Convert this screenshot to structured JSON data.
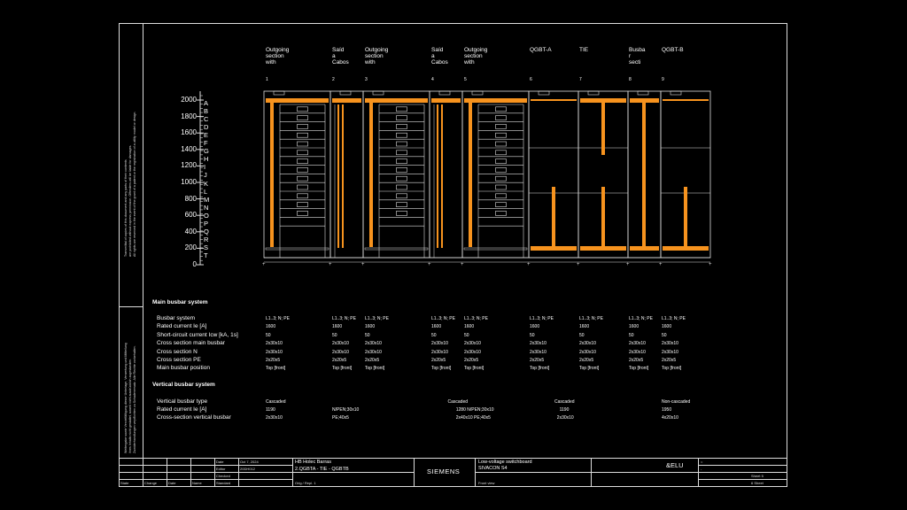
{
  "side_notes": {
    "top": [
      "Transmittal of copies of this document and any parts of their contents",
      "are prohibited without express permission. Offenders will be liable for damages.",
      "All rights are reserved in the event of the grant of a patent or the registration of a utility model or design."
    ],
    "bottom": [
      "Weitergabe sowie Vervielfältigung dieser Unterlage, Verwertung und Mitteilung",
      "ihres Inhalts nicht gestattet, soweit nicht ausdrücklich zugestanden.",
      "Zuwiderhandlungen verpflichten zu Schadenersatz. Alle Rechte vorbehalten."
    ]
  },
  "columns": [
    {
      "head": [
        "Outgoing",
        "section",
        "with"
      ],
      "num": "1"
    },
    {
      "head": [
        "Saíd",
        "a",
        "Cabos"
      ],
      "num": "2"
    },
    {
      "head": [
        "Outgoing",
        "section",
        "with"
      ],
      "num": "3"
    },
    {
      "head": [
        "Saíd",
        "a",
        "Cabos"
      ],
      "num": "4"
    },
    {
      "head": [
        "Outgoing",
        "section",
        "with"
      ],
      "num": "5"
    },
    {
      "head": [
        "QGBT-A"
      ],
      "num": "6"
    },
    {
      "head": [
        "TIE"
      ],
      "num": "7"
    },
    {
      "head": [
        "Busba",
        "r",
        "secti"
      ],
      "num": "8"
    },
    {
      "head": [
        "QGBT-B"
      ],
      "num": "9"
    }
  ],
  "y_axis": {
    "ticks": [
      "2000",
      "1800",
      "1600",
      "1400",
      "1200",
      "1000",
      "800",
      "600",
      "400",
      "200",
      "0"
    ],
    "letters": [
      "A",
      "B",
      "C",
      "D",
      "E",
      "F",
      "G",
      "H",
      "I",
      "J",
      "K",
      "L",
      "M",
      "N",
      "O",
      "P",
      "Q",
      "R",
      "S",
      "T"
    ]
  },
  "main_busbar": {
    "title": "Main busbar system",
    "rows": [
      {
        "label": "Busbar system",
        "values": [
          "L1..3; N; PE",
          "L1..3; N; PE",
          "L1..3; N; PE",
          "L1..3; N; PE",
          "L1..3; N; PE",
          "L1..3; N; PE",
          "L1..3; N; PE",
          "L1..3; N; PE",
          "L1..3; N; PE"
        ]
      },
      {
        "label": "Rated current Ie [A]",
        "values": [
          "1600",
          "1600",
          "1600",
          "1600",
          "1600",
          "1600",
          "1600",
          "1600",
          "1600"
        ]
      },
      {
        "label": "Short-circuit current Icw [kA, 1s]",
        "values": [
          "50",
          "50",
          "50",
          "50",
          "50",
          "50",
          "50",
          "50",
          "50"
        ]
      },
      {
        "label": "Cross section main busbar",
        "values": [
          "2x30x10",
          "2x30x10",
          "2x30x10",
          "2x30x10",
          "2x30x10",
          "2x30x10",
          "2x30x10",
          "2x30x10",
          "2x30x10"
        ]
      },
      {
        "label": "Cross section N",
        "values": [
          "2x30x10",
          "2x30x10",
          "2x30x10",
          "2x30x10",
          "2x30x10",
          "2x30x10",
          "2x30x10",
          "2x30x10",
          "2x30x10"
        ]
      },
      {
        "label": "Cross section PE",
        "values": [
          "2x20x5",
          "2x20x5",
          "2x20x5",
          "2x20x5",
          "2x20x5",
          "2x20x5",
          "2x20x5",
          "2x20x5",
          "2x20x5"
        ]
      },
      {
        "label": "Main busbar position",
        "values": [
          "Top [front]",
          "Top [front]",
          "Top [front]",
          "Top [front]",
          "Top [front]",
          "Top [front]",
          "Top [front]",
          "Top [front]",
          "Top [front]"
        ]
      }
    ]
  },
  "vertical_busbar": {
    "title": "Vertical busbar system",
    "rows": [
      {
        "label": "Vertical busbar type",
        "cells": [
          {
            "c": 0,
            "t": "Cascaded"
          },
          {
            "c": 3.5,
            "t": "Cascaded"
          },
          {
            "c": 5.5,
            "t": "Cascaded"
          },
          {
            "c": 8,
            "t": "Non-cascaded"
          }
        ]
      },
      {
        "label": "Rated current Ie [A]",
        "cells": [
          {
            "c": 0,
            "t": "1190"
          },
          {
            "c": 1,
            "t": "N/PEN;30x10"
          },
          {
            "c": 3.75,
            "t": "1280 N/PEN;30x10"
          },
          {
            "c": 5.6,
            "t": "1190"
          },
          {
            "c": 8,
            "t": "1950"
          }
        ]
      },
      {
        "label": "Cross-section vertical busbar",
        "cells": [
          {
            "c": 0,
            "t": "2x30x10"
          },
          {
            "c": 1,
            "t": "PE;40x5"
          },
          {
            "c": 3.75,
            "t": "2x40x10 PE;40x5"
          },
          {
            "c": 5.55,
            "t": "2x30x10"
          },
          {
            "c": 8,
            "t": "4x20x10"
          }
        ]
      }
    ]
  },
  "title_block": {
    "date_label": "Date",
    "date_value": "Oct 7, 2024",
    "editor_label": "Editor",
    "editor_value": "20DH012",
    "checked_label": "Checked",
    "state_label": "State",
    "change_label": "Change",
    "date2_label": "Date",
    "name_label": "Name",
    "standard_label": "Standard",
    "project": "HB Holec Barras",
    "subtitle": "2.QGBTA - TIE - QGBTB",
    "orig": "Orig / Repl. 1",
    "brand": "SIEMENS",
    "desc1": "Low-voltage switchboard",
    "desc2": "SIVACON S4",
    "view": "Front view",
    "code": "&ELU",
    "eq": "=",
    "minus": "-",
    "sheet": "Sheet 5",
    "sheets": "6 Sheet"
  },
  "colors": {
    "busbar": "#f7931e",
    "line": "#dddddd",
    "bg": "#000000"
  }
}
